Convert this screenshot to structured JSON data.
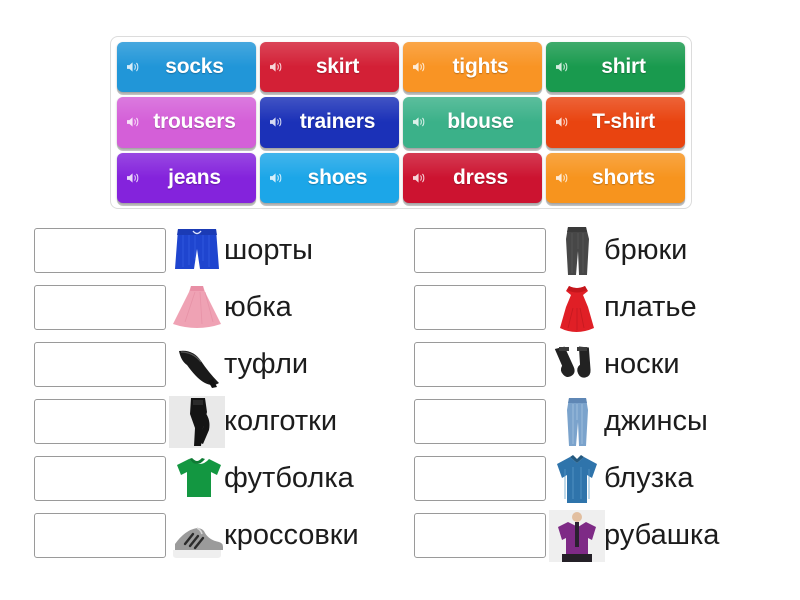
{
  "wordbank": {
    "tiles": [
      {
        "label": "socks",
        "color": "#2196d8",
        "icon": "speaker-icon"
      },
      {
        "label": "skirt",
        "color": "#d32036",
        "icon": "speaker-icon"
      },
      {
        "label": "tights",
        "color": "#f99424",
        "icon": "speaker-icon"
      },
      {
        "label": "shirt",
        "color": "#199a4e",
        "icon": "speaker-icon"
      },
      {
        "label": "trousers",
        "color": "#d45fd8",
        "icon": "speaker-icon"
      },
      {
        "label": "trainers",
        "color": "#1b31b8",
        "icon": "speaker-icon"
      },
      {
        "label": "blouse",
        "color": "#3bb189",
        "icon": "speaker-icon"
      },
      {
        "label": "T-shirt",
        "color": "#e94410",
        "icon": "speaker-icon"
      },
      {
        "label": "jeans",
        "color": "#8423dc",
        "icon": "speaker-icon"
      },
      {
        "label": "shoes",
        "color": "#1ca6e8",
        "icon": "speaker-icon"
      },
      {
        "label": "dress",
        "color": "#cc1330",
        "icon": "speaker-icon"
      },
      {
        "label": "shorts",
        "color": "#f7941e",
        "icon": "speaker-icon"
      }
    ]
  },
  "answers": {
    "left_column": [
      {
        "word": "шорты",
        "art": "blue-shorts-image",
        "dropbox_value": ""
      },
      {
        "word": "юбка",
        "art": "pink-skirt-image",
        "dropbox_value": ""
      },
      {
        "word": "туфли",
        "art": "black-high-heel-image",
        "dropbox_value": ""
      },
      {
        "word": "колготки",
        "art": "black-tights-image",
        "dropbox_value": ""
      },
      {
        "word": "футболка",
        "art": "green-tshirt-image",
        "dropbox_value": ""
      },
      {
        "word": "кроссовки",
        "art": "grey-trainers-image",
        "dropbox_value": ""
      }
    ],
    "right_column": [
      {
        "word": "брюки",
        "art": "grey-trousers-image",
        "dropbox_value": ""
      },
      {
        "word": "платье",
        "art": "red-dress-image",
        "dropbox_value": ""
      },
      {
        "word": "носки",
        "art": "black-socks-image",
        "dropbox_value": ""
      },
      {
        "word": "джинсы",
        "art": "blue-jeans-image",
        "dropbox_value": ""
      },
      {
        "word": "блузка",
        "art": "blue-blouse-image",
        "dropbox_value": ""
      },
      {
        "word": "рубашка",
        "art": "purple-shirt-image",
        "dropbox_value": ""
      }
    ]
  },
  "colors": {
    "panel_border": "#dcdcdc",
    "dropbox_border": "#9a9a9a",
    "word_text": "#1c1c1c",
    "tile_text": "#ffffff",
    "background": "#ffffff"
  }
}
